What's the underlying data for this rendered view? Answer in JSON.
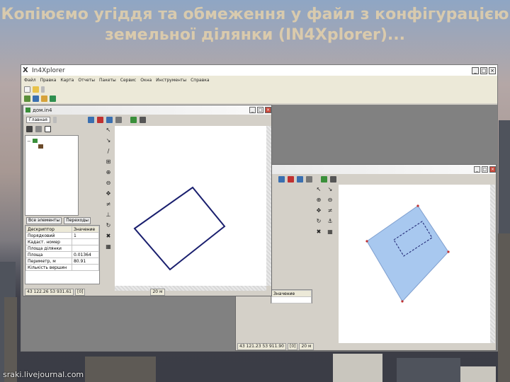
{
  "slide": {
    "title": "Копіюємо угіддя та обмеження у файл з конфігурацією земельної ділянки (IN4Xplorer)..."
  },
  "watermark": "sraki.livejournal.com",
  "app": {
    "title": "In4Xplorer",
    "menu": [
      "Файл",
      "Правка",
      "Карта",
      "Отчеты",
      "Пакеты",
      "Сервис",
      "Окна",
      "Инструменты",
      "Справка"
    ],
    "child1": {
      "title": "дом.in4",
      "tool_label": "Главная",
      "tabs": [
        "Все элементы",
        "Переходы"
      ],
      "props_header": [
        "Дескриптор",
        "Значение"
      ],
      "props_rows": [
        [
          "Порядковий",
          "1"
        ],
        [
          "Кадаст. номер",
          ""
        ],
        [
          "Площа ділянки",
          ""
        ],
        [
          "Площа",
          "0.01364"
        ],
        [
          "Периметр, м",
          "80.91"
        ],
        [
          "Кількість вершин",
          ""
        ]
      ],
      "status": [
        "43 122.26  53 931.61",
        "[0]",
        "20 м"
      ]
    },
    "child2": {
      "props_header": "Значение",
      "status": [
        "43 121.23  53 911.90",
        "[0]",
        "20 м"
      ]
    }
  },
  "colors": {
    "polygon_stroke": "#1a1f6e",
    "parcel_fill": "#a8c8ef",
    "vertex": "#c03030"
  }
}
